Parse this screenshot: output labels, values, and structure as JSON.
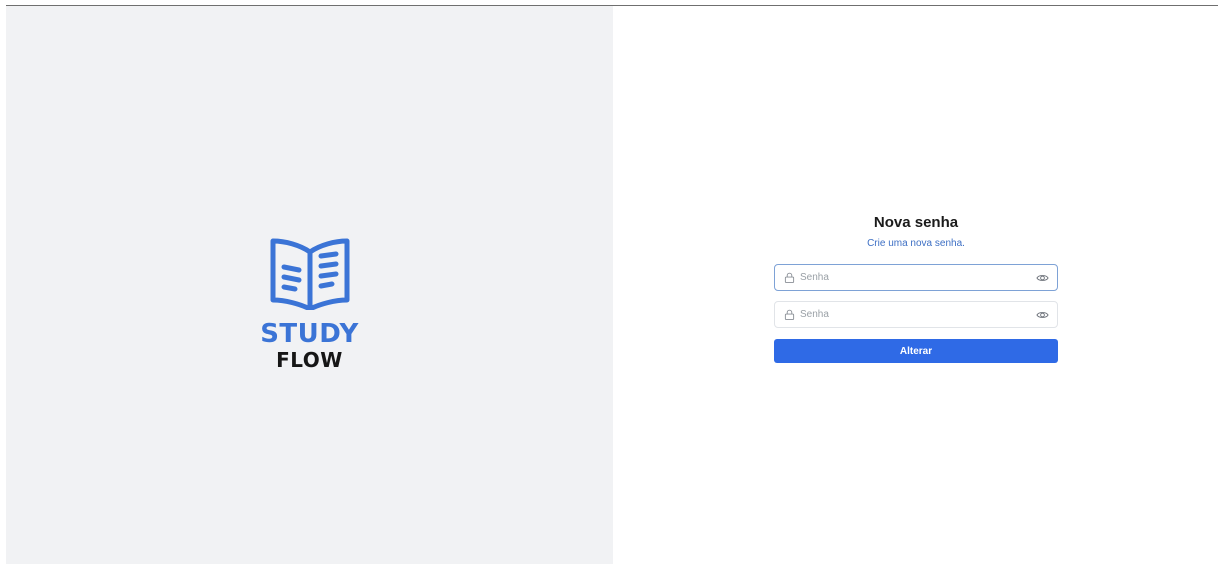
{
  "logo": {
    "top_text": "STUDY",
    "bottom_text": "FLOW",
    "icon": "open-book-icon",
    "accent_color": "#3b74d6"
  },
  "form": {
    "title": "Nova senha",
    "subtitle": "Crie uma nova senha.",
    "password_field": {
      "placeholder": "Senha",
      "value": ""
    },
    "confirm_field": {
      "placeholder": "Senha",
      "value": ""
    },
    "submit_label": "Alterar",
    "button_color": "#2f6ae6",
    "icons": [
      "lock-icon",
      "eye-icon"
    ]
  }
}
